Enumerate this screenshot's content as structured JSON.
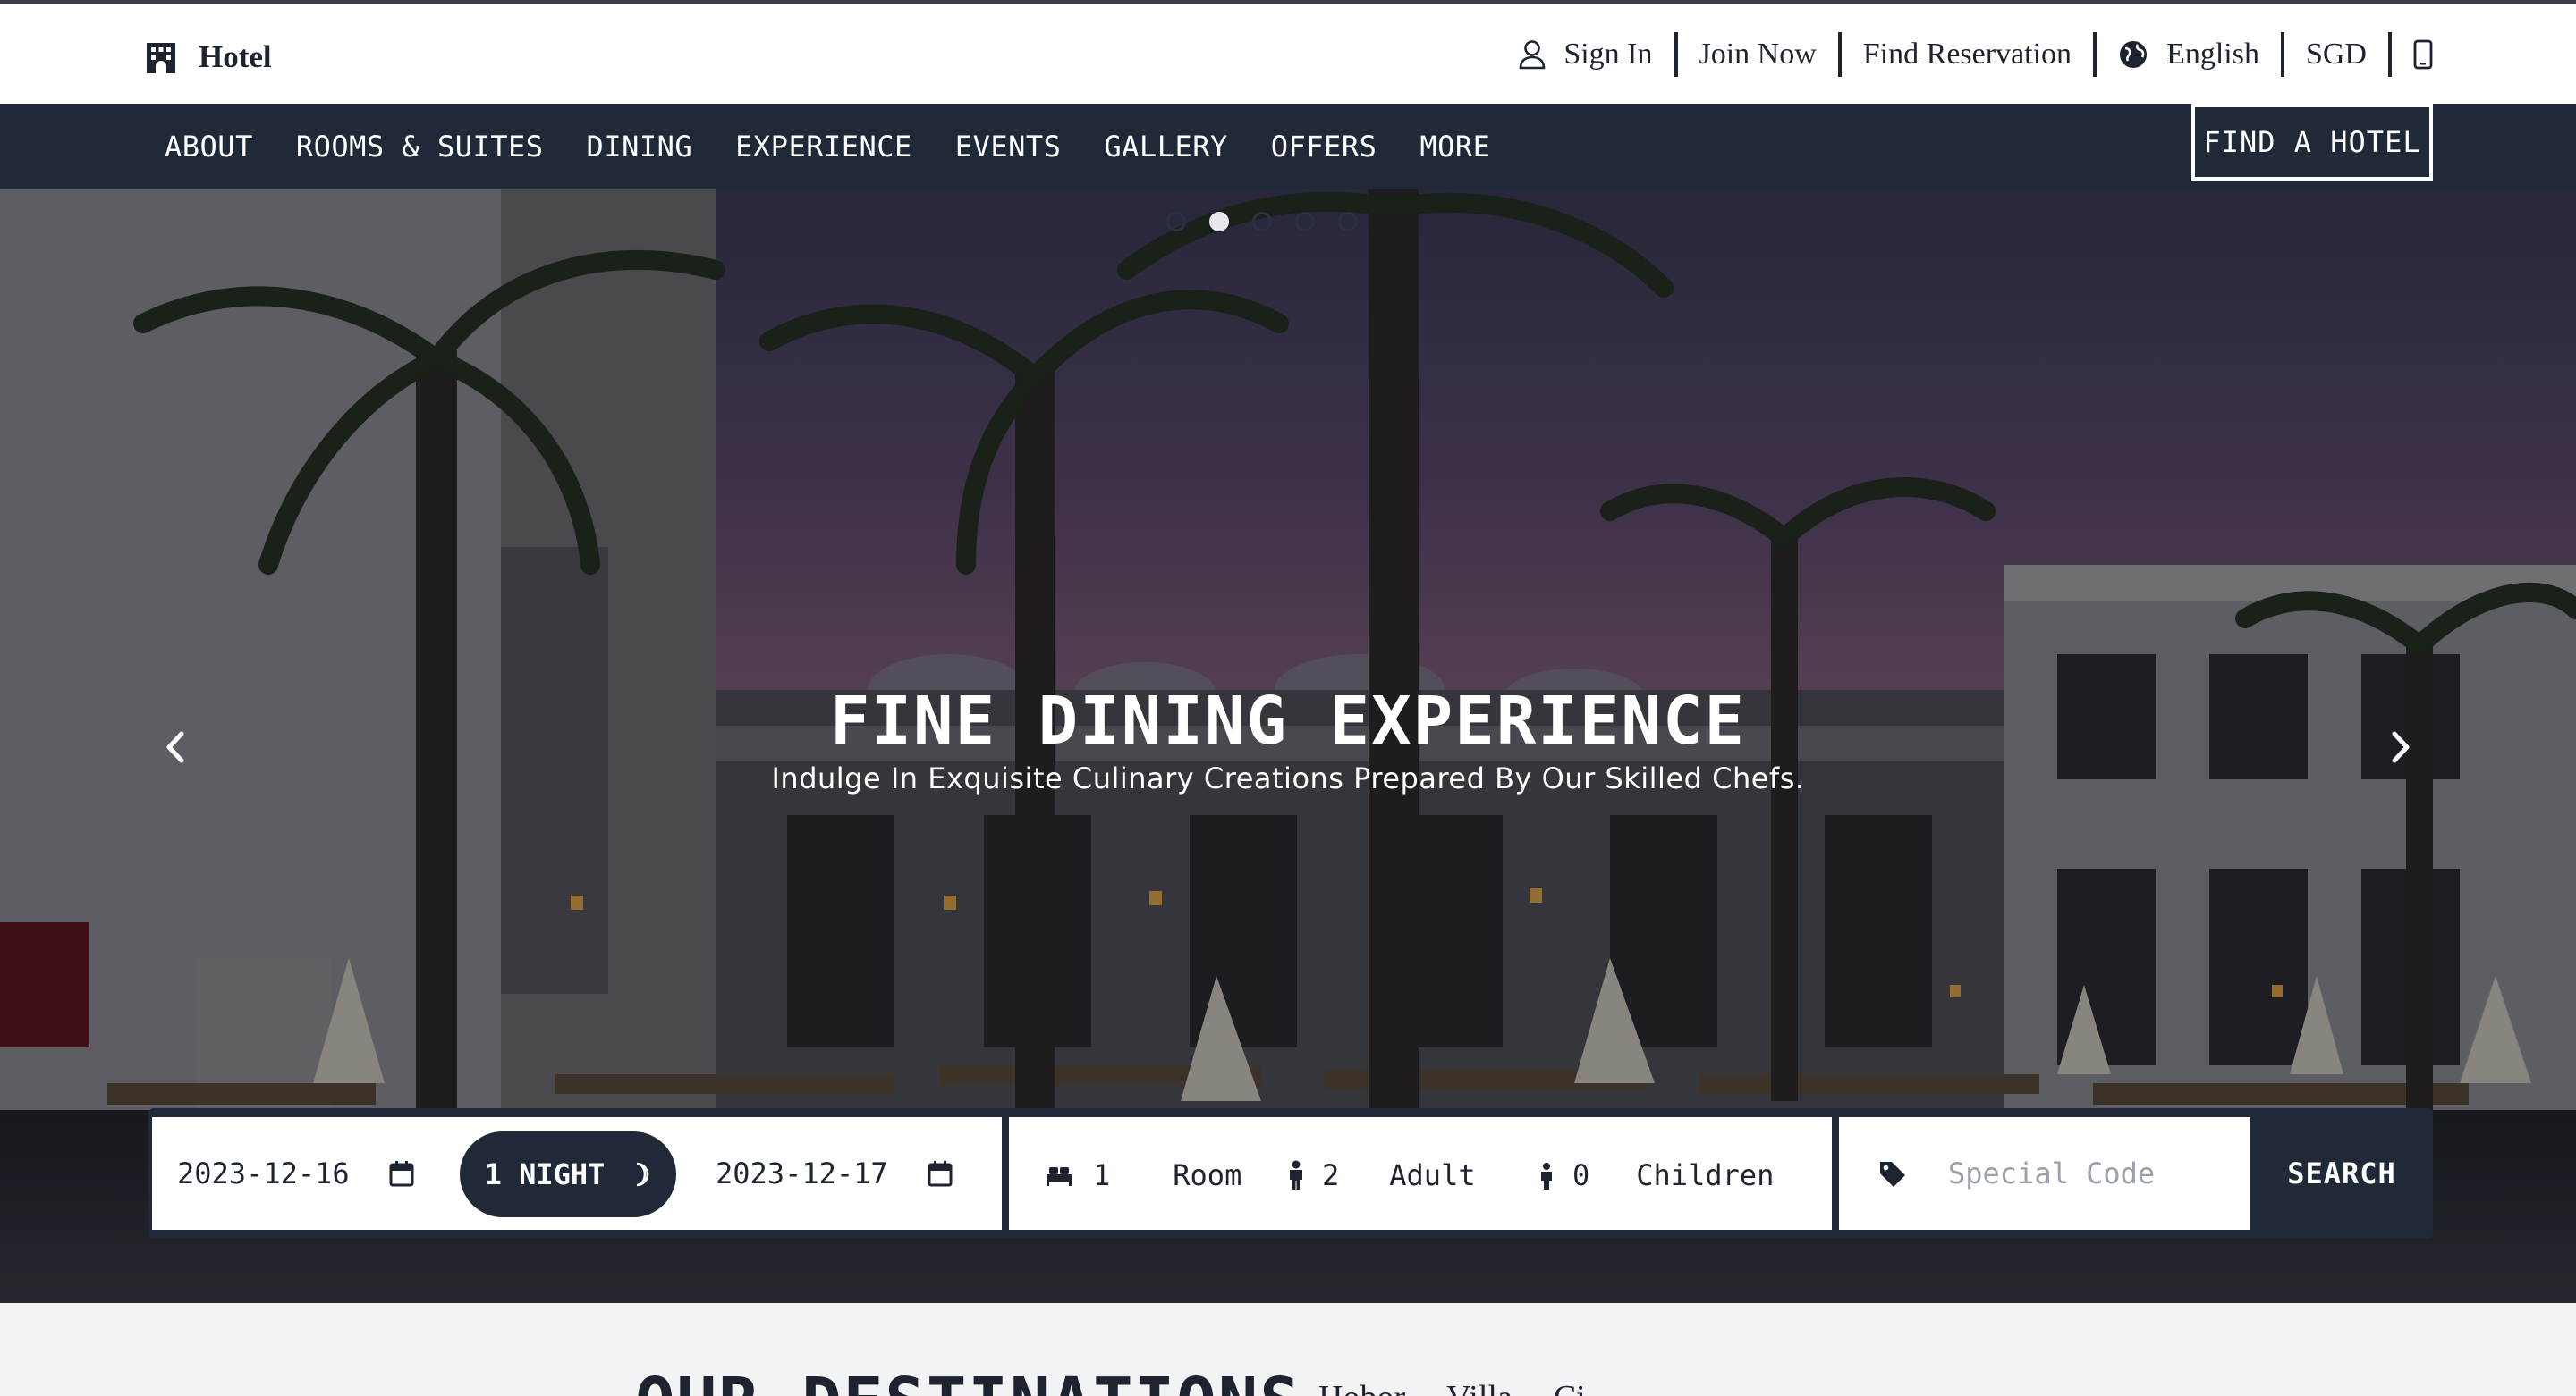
{
  "brand": {
    "name": "Hotel",
    "icon": "hotel-building-icon"
  },
  "utility_nav": {
    "sign_in": "Sign In",
    "join_now": "Join Now",
    "find_reservation": "Find Reservation",
    "language": "English",
    "currency": "SGD",
    "icons": [
      "user-icon",
      "globe-icon",
      "mobile-phone-icon"
    ]
  },
  "main_nav": {
    "items": [
      "ABOUT",
      "ROOMS & SUITES",
      "DINING",
      "EXPERIENCE",
      "EVENTS",
      "GALLERY",
      "OFFERS",
      "MORE"
    ],
    "find_hotel": "FIND A HOTEL"
  },
  "hero": {
    "title": "FINE DINING EXPERIENCE",
    "subtitle": "Indulge In Exquisite Culinary Creations Prepared By Our Skilled Chefs.",
    "slide_count": 5,
    "active_slide": 2,
    "icons": [
      "chevron-left-icon",
      "chevron-right-icon"
    ]
  },
  "booking": {
    "check_in": "2023-12-16",
    "nights_label": "1 NIGHT",
    "check_out": "2023-12-17",
    "rooms_value": "1",
    "rooms_label": "Room",
    "adults_value": "2",
    "adults_label": "Adult",
    "children_value": "0",
    "children_label": "Children",
    "code_placeholder": "Special Code",
    "search_label": "SEARCH",
    "icons": [
      "calendar-icon",
      "moon-icon",
      "bed-icon",
      "adult-icon",
      "child-icon",
      "tag-icon"
    ]
  },
  "destinations": {
    "title": "OUR DESTINATIONS",
    "tabs": [
      "Hobor",
      "Villa",
      "Ci"
    ]
  },
  "colors": {
    "nav_dark": "#1f2937",
    "white": "#ffffff",
    "page_bg": "#f1f3f5",
    "text_dark": "#1d2430"
  }
}
